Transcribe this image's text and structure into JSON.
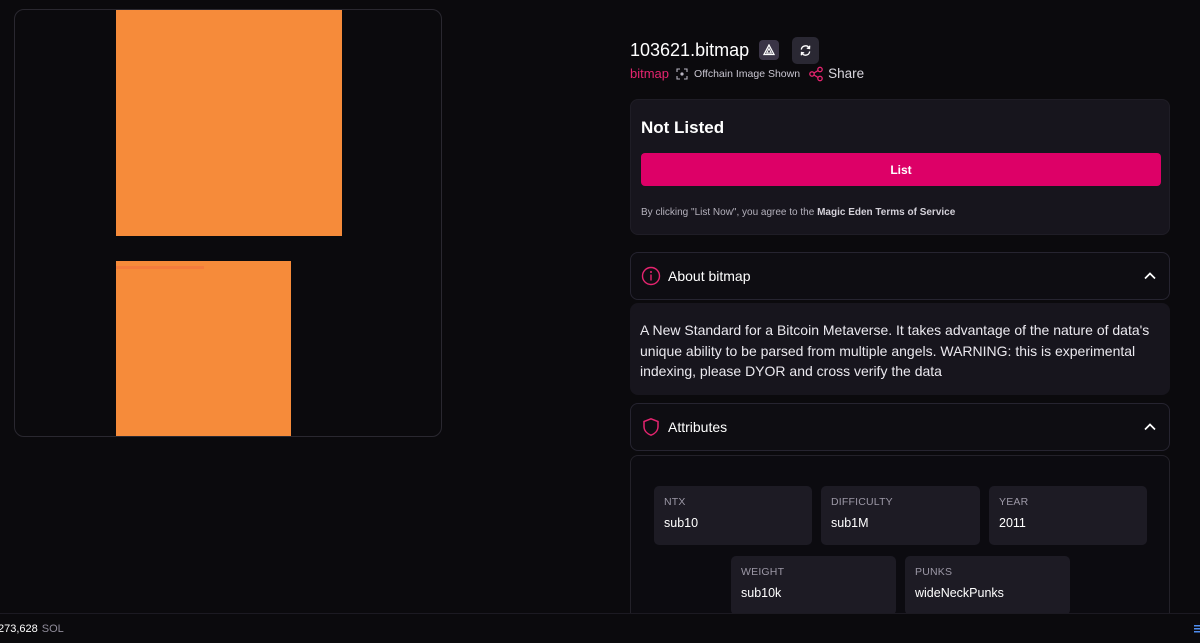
{
  "item": {
    "title": "103621.bitmap",
    "collection": "bitmap",
    "offchain_label": "Offchain Image Shown",
    "share_label": "Share"
  },
  "listing": {
    "status": "Not Listed",
    "button_label": "List",
    "terms_prefix": "By clicking \"List Now\", you agree to the",
    "terms_link": "Magic Eden Terms of Service"
  },
  "about": {
    "header": "About bitmap",
    "description": "A New Standard for a Bitcoin Metaverse. It takes advantage of the nature of data's unique ability to be parsed from multiple angels. WARNING: this is experimental indexing, please DYOR and cross verify the data"
  },
  "attributes": {
    "header": "Attributes",
    "items": [
      {
        "key": "NTX",
        "value": "sub10"
      },
      {
        "key": "DIFFICULTY",
        "value": "sub1M"
      },
      {
        "key": "YEAR",
        "value": "2011"
      },
      {
        "key": "WEIGHT",
        "value": "sub10k"
      },
      {
        "key": "PUNKS",
        "value": "wideNeckPunks"
      }
    ]
  },
  "footer": {
    "amount": "273,628",
    "unit": "SOL"
  },
  "colors": {
    "accent": "#dd0067",
    "collection_link": "#e5246f",
    "art": "#f68b3a",
    "background": "#0b0a0d"
  },
  "icons": [
    "ordinals-badge-icon",
    "refresh-icon",
    "offchain-icon",
    "share-icon",
    "info-icon",
    "chevron-up-icon",
    "shield-icon",
    "menu-icon"
  ]
}
